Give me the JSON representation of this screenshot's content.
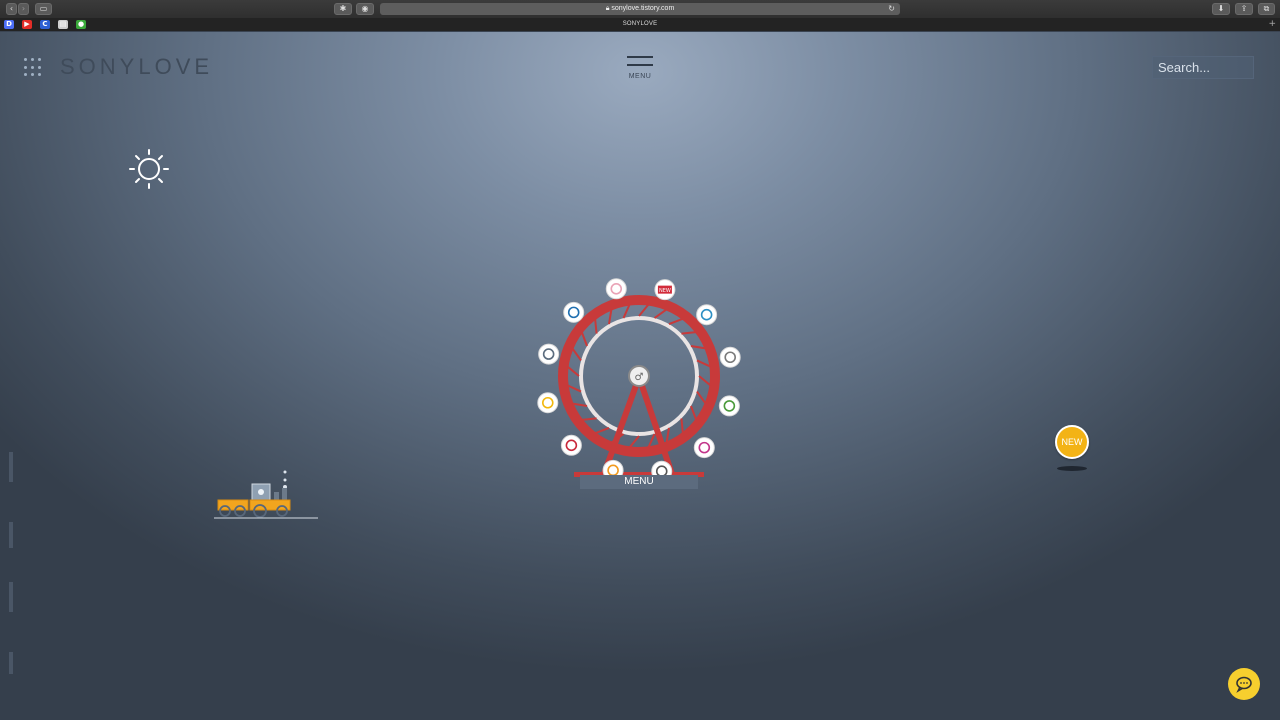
{
  "browser": {
    "url": "sonylove.tistory.com",
    "tab_title": "SONYLOVE",
    "favicons": [
      {
        "name": "d-favicon",
        "label": "D",
        "color": "#4c6ef5"
      },
      {
        "name": "youtube-favicon",
        "label": "▶",
        "color": "#e52d27"
      },
      {
        "name": "c-favicon",
        "label": "C",
        "color": "#2d5fd3"
      },
      {
        "name": "page-favicon",
        "label": "▤",
        "color": "#cfcfcf"
      },
      {
        "name": "green-favicon",
        "label": "●",
        "color": "#3aa93a"
      }
    ]
  },
  "header": {
    "logo": "SONYLOVE",
    "menu_label": "MENU",
    "search_placeholder": "Search..."
  },
  "wheel": {
    "menu_label": "MENU",
    "center_label": "♂",
    "icons": [
      "cup-icon",
      "new-tag-icon",
      "clock-icon",
      "tools-icon",
      "tree-icon",
      "info-icon",
      "pencil-icon",
      "smile-icon",
      "disc-icon",
      "speaker-icon",
      "display-icon",
      "camera-icon"
    ],
    "new_tag": "NEW"
  },
  "badge": {
    "new_label": "NEW"
  },
  "colors": {
    "wheel_red": "#c83a3a",
    "badge_yellow": "#f3b316",
    "chat_yellow": "#f7cf2e"
  }
}
